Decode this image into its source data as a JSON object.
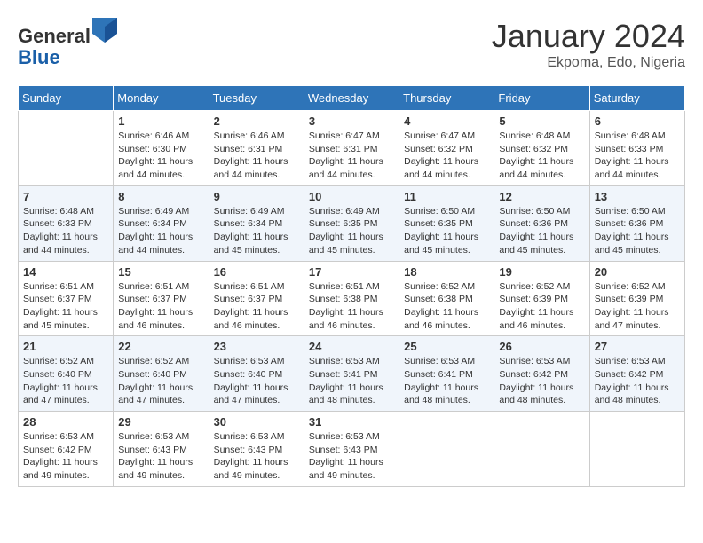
{
  "header": {
    "logo_line1": "General",
    "logo_line2": "Blue",
    "month": "January 2024",
    "location": "Ekpoma, Edo, Nigeria"
  },
  "weekdays": [
    "Sunday",
    "Monday",
    "Tuesday",
    "Wednesday",
    "Thursday",
    "Friday",
    "Saturday"
  ],
  "weeks": [
    [
      {
        "day": "",
        "sunrise": "",
        "sunset": "",
        "daylight": ""
      },
      {
        "day": "1",
        "sunrise": "Sunrise: 6:46 AM",
        "sunset": "Sunset: 6:30 PM",
        "daylight": "Daylight: 11 hours and 44 minutes."
      },
      {
        "day": "2",
        "sunrise": "Sunrise: 6:46 AM",
        "sunset": "Sunset: 6:31 PM",
        "daylight": "Daylight: 11 hours and 44 minutes."
      },
      {
        "day": "3",
        "sunrise": "Sunrise: 6:47 AM",
        "sunset": "Sunset: 6:31 PM",
        "daylight": "Daylight: 11 hours and 44 minutes."
      },
      {
        "day": "4",
        "sunrise": "Sunrise: 6:47 AM",
        "sunset": "Sunset: 6:32 PM",
        "daylight": "Daylight: 11 hours and 44 minutes."
      },
      {
        "day": "5",
        "sunrise": "Sunrise: 6:48 AM",
        "sunset": "Sunset: 6:32 PM",
        "daylight": "Daylight: 11 hours and 44 minutes."
      },
      {
        "day": "6",
        "sunrise": "Sunrise: 6:48 AM",
        "sunset": "Sunset: 6:33 PM",
        "daylight": "Daylight: 11 hours and 44 minutes."
      }
    ],
    [
      {
        "day": "7",
        "sunrise": "Sunrise: 6:48 AM",
        "sunset": "Sunset: 6:33 PM",
        "daylight": "Daylight: 11 hours and 44 minutes."
      },
      {
        "day": "8",
        "sunrise": "Sunrise: 6:49 AM",
        "sunset": "Sunset: 6:34 PM",
        "daylight": "Daylight: 11 hours and 44 minutes."
      },
      {
        "day": "9",
        "sunrise": "Sunrise: 6:49 AM",
        "sunset": "Sunset: 6:34 PM",
        "daylight": "Daylight: 11 hours and 45 minutes."
      },
      {
        "day": "10",
        "sunrise": "Sunrise: 6:49 AM",
        "sunset": "Sunset: 6:35 PM",
        "daylight": "Daylight: 11 hours and 45 minutes."
      },
      {
        "day": "11",
        "sunrise": "Sunrise: 6:50 AM",
        "sunset": "Sunset: 6:35 PM",
        "daylight": "Daylight: 11 hours and 45 minutes."
      },
      {
        "day": "12",
        "sunrise": "Sunrise: 6:50 AM",
        "sunset": "Sunset: 6:36 PM",
        "daylight": "Daylight: 11 hours and 45 minutes."
      },
      {
        "day": "13",
        "sunrise": "Sunrise: 6:50 AM",
        "sunset": "Sunset: 6:36 PM",
        "daylight": "Daylight: 11 hours and 45 minutes."
      }
    ],
    [
      {
        "day": "14",
        "sunrise": "Sunrise: 6:51 AM",
        "sunset": "Sunset: 6:37 PM",
        "daylight": "Daylight: 11 hours and 45 minutes."
      },
      {
        "day": "15",
        "sunrise": "Sunrise: 6:51 AM",
        "sunset": "Sunset: 6:37 PM",
        "daylight": "Daylight: 11 hours and 46 minutes."
      },
      {
        "day": "16",
        "sunrise": "Sunrise: 6:51 AM",
        "sunset": "Sunset: 6:37 PM",
        "daylight": "Daylight: 11 hours and 46 minutes."
      },
      {
        "day": "17",
        "sunrise": "Sunrise: 6:51 AM",
        "sunset": "Sunset: 6:38 PM",
        "daylight": "Daylight: 11 hours and 46 minutes."
      },
      {
        "day": "18",
        "sunrise": "Sunrise: 6:52 AM",
        "sunset": "Sunset: 6:38 PM",
        "daylight": "Daylight: 11 hours and 46 minutes."
      },
      {
        "day": "19",
        "sunrise": "Sunrise: 6:52 AM",
        "sunset": "Sunset: 6:39 PM",
        "daylight": "Daylight: 11 hours and 46 minutes."
      },
      {
        "day": "20",
        "sunrise": "Sunrise: 6:52 AM",
        "sunset": "Sunset: 6:39 PM",
        "daylight": "Daylight: 11 hours and 47 minutes."
      }
    ],
    [
      {
        "day": "21",
        "sunrise": "Sunrise: 6:52 AM",
        "sunset": "Sunset: 6:40 PM",
        "daylight": "Daylight: 11 hours and 47 minutes."
      },
      {
        "day": "22",
        "sunrise": "Sunrise: 6:52 AM",
        "sunset": "Sunset: 6:40 PM",
        "daylight": "Daylight: 11 hours and 47 minutes."
      },
      {
        "day": "23",
        "sunrise": "Sunrise: 6:53 AM",
        "sunset": "Sunset: 6:40 PM",
        "daylight": "Daylight: 11 hours and 47 minutes."
      },
      {
        "day": "24",
        "sunrise": "Sunrise: 6:53 AM",
        "sunset": "Sunset: 6:41 PM",
        "daylight": "Daylight: 11 hours and 48 minutes."
      },
      {
        "day": "25",
        "sunrise": "Sunrise: 6:53 AM",
        "sunset": "Sunset: 6:41 PM",
        "daylight": "Daylight: 11 hours and 48 minutes."
      },
      {
        "day": "26",
        "sunrise": "Sunrise: 6:53 AM",
        "sunset": "Sunset: 6:42 PM",
        "daylight": "Daylight: 11 hours and 48 minutes."
      },
      {
        "day": "27",
        "sunrise": "Sunrise: 6:53 AM",
        "sunset": "Sunset: 6:42 PM",
        "daylight": "Daylight: 11 hours and 48 minutes."
      }
    ],
    [
      {
        "day": "28",
        "sunrise": "Sunrise: 6:53 AM",
        "sunset": "Sunset: 6:42 PM",
        "daylight": "Daylight: 11 hours and 49 minutes."
      },
      {
        "day": "29",
        "sunrise": "Sunrise: 6:53 AM",
        "sunset": "Sunset: 6:43 PM",
        "daylight": "Daylight: 11 hours and 49 minutes."
      },
      {
        "day": "30",
        "sunrise": "Sunrise: 6:53 AM",
        "sunset": "Sunset: 6:43 PM",
        "daylight": "Daylight: 11 hours and 49 minutes."
      },
      {
        "day": "31",
        "sunrise": "Sunrise: 6:53 AM",
        "sunset": "Sunset: 6:43 PM",
        "daylight": "Daylight: 11 hours and 49 minutes."
      },
      {
        "day": "",
        "sunrise": "",
        "sunset": "",
        "daylight": ""
      },
      {
        "day": "",
        "sunrise": "",
        "sunset": "",
        "daylight": ""
      },
      {
        "day": "",
        "sunrise": "",
        "sunset": "",
        "daylight": ""
      }
    ]
  ]
}
